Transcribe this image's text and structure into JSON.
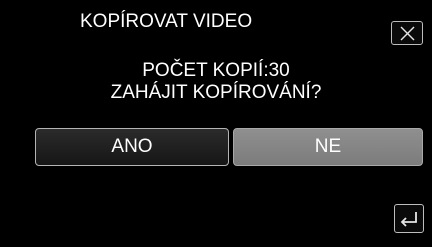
{
  "dialog": {
    "title": "KOPÍROVAT VIDEO",
    "message_line1": "POČET KOPIÍ:30",
    "message_line2": "ZAHÁJIT KOPÍROVÁNÍ?"
  },
  "buttons": {
    "yes_label": "ANO",
    "no_label": "NE",
    "no_selected": true
  },
  "icons": {
    "close": "close-icon",
    "back": "return-arrow-icon"
  },
  "colors": {
    "background": "#000000",
    "text": "#ffffff",
    "selected_button": "#868686",
    "button_border": "#b4b4b4"
  }
}
